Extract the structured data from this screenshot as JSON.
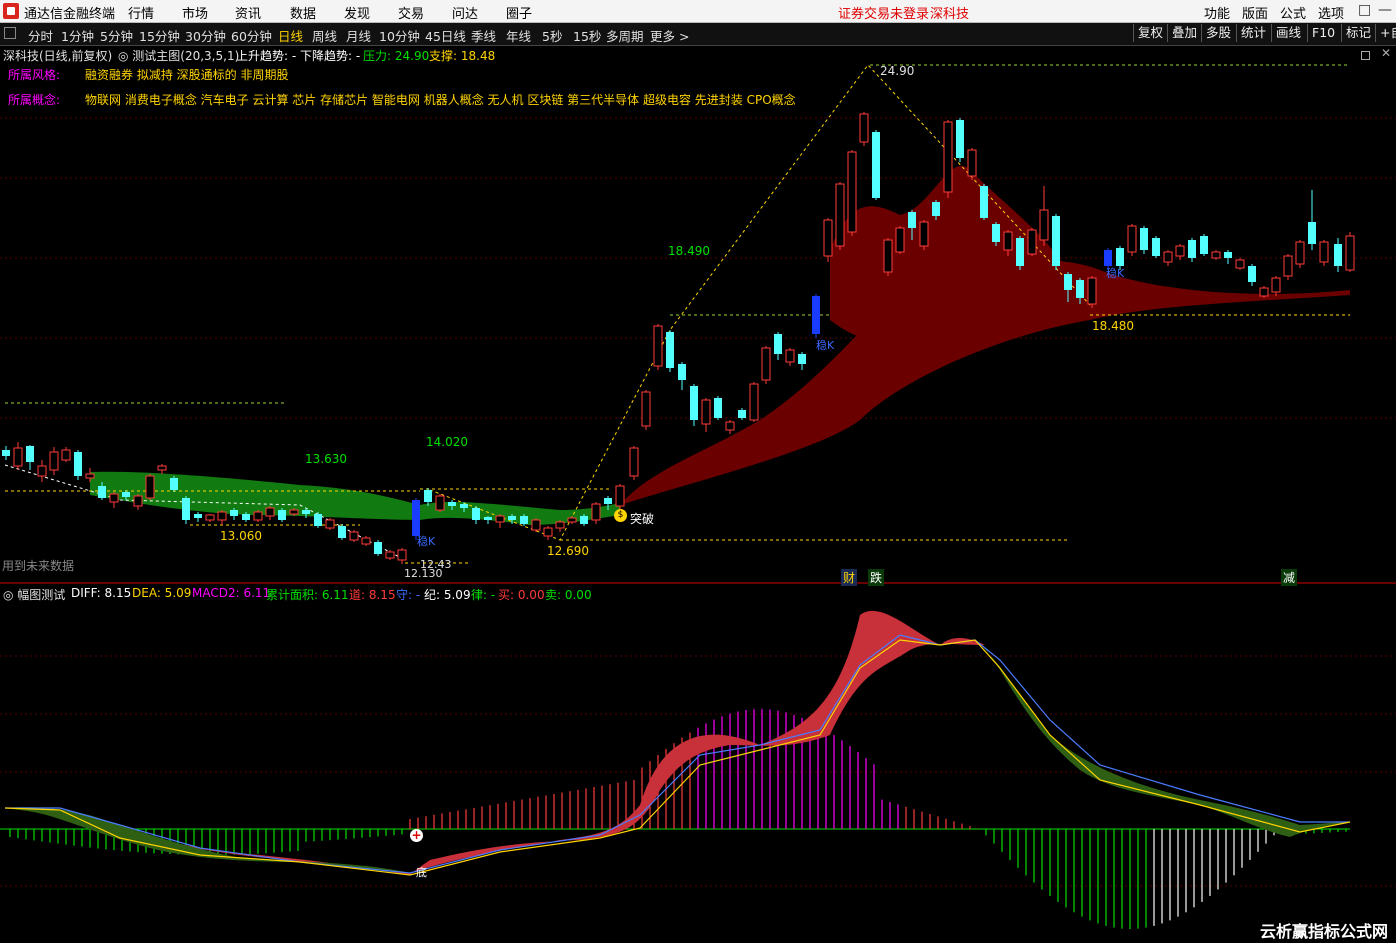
{
  "menubar": {
    "app_title": "通达信金融终端",
    "menus": [
      "行情",
      "市场",
      "资讯",
      "数据",
      "发现",
      "交易",
      "问达",
      "圈子"
    ],
    "status": "证券交易未登录",
    "stock": "深科技",
    "right_menus": [
      "功能",
      "版面",
      "公式",
      "选项"
    ],
    "window_icons": [
      "□",
      "—"
    ]
  },
  "periods": {
    "items": [
      "分时",
      "1分钟",
      "5分钟",
      "15分钟",
      "30分钟",
      "60分钟",
      "日线",
      "周线",
      "月线",
      "10分钟",
      "45日线",
      "季线",
      "年线",
      "5秒",
      "15秒",
      "多周期",
      "更多 >"
    ],
    "active": "日线",
    "right_buttons": [
      "复权",
      "叠加",
      "多股",
      "统计",
      "画线",
      "F10",
      "标记",
      "+自"
    ]
  },
  "main": {
    "title_stock": "深科技(日线,前复权)",
    "title_formula": "◎ 测试主图(20,3,5,1)",
    "uptrend_label": "上升趋势: -",
    "downtrend_label": "下降趋势: -",
    "pressure_label": "压力: 24.90",
    "support_label": "支撑: 18.48",
    "style_label": "所属风格:",
    "style_value": "融资融券 拟减持 深股通标的 非周期股",
    "concept_label": "所属概念:",
    "concept_value": "物联网 消费电子概念 汽车电子 云计算 芯片 存储芯片 智能电网 机器人概念 无人机 区块链 第三代半导体 超级电容 先进封装 CPO概念",
    "future_note": "用到未来数据",
    "price_labels": {
      "p2490": "24.90",
      "p18490": "18.490",
      "p18480": "18.480",
      "p13630": "13.630",
      "p14020": "14.020",
      "p13060": "13.060",
      "p12690": "12.690",
      "p1243": "12.43",
      "p12130": "12.130"
    },
    "signals": {
      "breakout": "突破",
      "wen1": "稳K",
      "wen2": "稳K",
      "wen3": "稳K"
    },
    "bottom_tags": [
      "财",
      "跌",
      "减"
    ],
    "colors": {
      "up": "#ff3b3b",
      "down": "#54ffff",
      "band_up": "#6b0000",
      "band_down": "#117a11",
      "dash_yellow": "#ffd700",
      "dash_green": "#9bd43a"
    }
  },
  "sub": {
    "title": "◎ 幅图测试",
    "diff": "DIFF: 8.15",
    "dea": "DEA: 5.09",
    "macd2": "MACD2: 6.11",
    "area": "累计面积: 6.11",
    "dao": "道: 8.15",
    "shou": "守: -",
    "ji": "纪: 5.09",
    "lv": "律: -",
    "mai": "买: 0.00",
    "sell": "卖: 0.00",
    "low_mark": "底"
  },
  "watermark": "云析赢指标公式网"
}
